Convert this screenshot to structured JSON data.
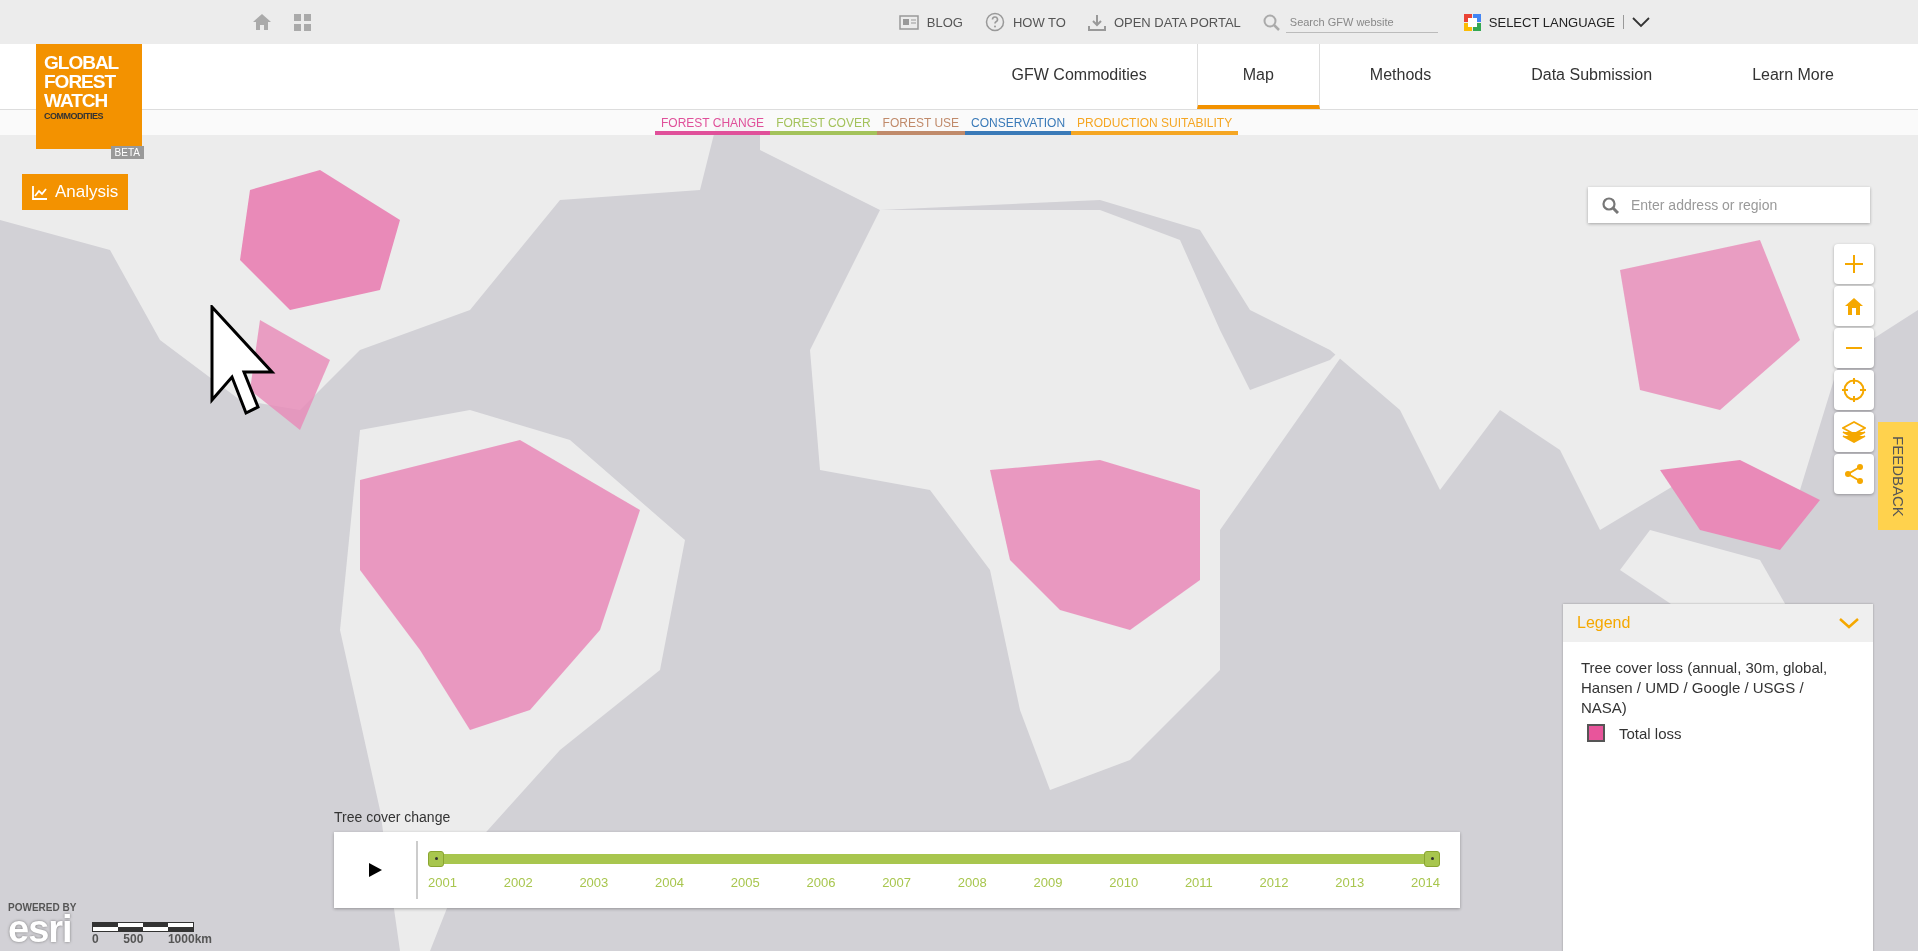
{
  "top_bar": {
    "links": [
      {
        "label": "BLOG",
        "kind": "blog"
      },
      {
        "label": "HOW TO",
        "kind": "help"
      },
      {
        "label": "OPEN DATA PORTAL",
        "kind": "download"
      }
    ],
    "search": {
      "placeholder": "Search GFW website"
    },
    "language": "SELECT LANGUAGE"
  },
  "logo": {
    "lines": [
      "GLOBAL",
      "FOREST",
      "WATCH"
    ],
    "subtitle": "COMMODITIES",
    "badge": "BETA"
  },
  "nav": [
    {
      "label": "GFW Commodities",
      "selected": false
    },
    {
      "label": "Map",
      "selected": true
    },
    {
      "label": "Methods",
      "selected": false
    },
    {
      "label": "Data Submission",
      "selected": false
    },
    {
      "label": "Learn More",
      "selected": false
    }
  ],
  "layer_tabs": [
    {
      "label": "FOREST CHANGE",
      "color": "#e0509a"
    },
    {
      "label": "FOREST COVER",
      "color": "#a3c25a"
    },
    {
      "label": "FOREST USE",
      "color": "#c08a6a"
    },
    {
      "label": "CONSERVATION",
      "color": "#3a7ab8"
    },
    {
      "label": "PRODUCTION SUITABILITY",
      "color": "#f5a623"
    }
  ],
  "analysis_button": "Analysis",
  "map_search": {
    "placeholder": "Enter address or region"
  },
  "feedback": "FEEDBACK",
  "legend": {
    "title": "Legend",
    "layer": "Tree cover loss (annual, 30m, global, Hansen / UMD / Google / USGS / NASA)",
    "items": [
      {
        "label": "Total loss"
      }
    ]
  },
  "timeline": {
    "label": "Tree cover change",
    "handles": [
      {
        "level": 0
      },
      {
        "level": 1
      }
    ],
    "years": [
      "2001",
      "2002",
      "2003",
      "2004",
      "2005",
      "2006",
      "2007",
      "2008",
      "2009",
      "2010",
      "2011",
      "2012",
      "2013",
      "2014"
    ]
  },
  "attribution": {
    "powered": "POWERED BY",
    "brand": "esri"
  },
  "scale": [
    "0",
    "500",
    "1000km"
  ]
}
